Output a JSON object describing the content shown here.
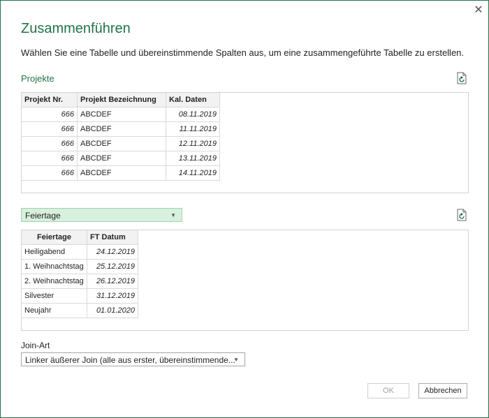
{
  "dialog": {
    "title": "Zusammenführen",
    "description": "Wählen Sie eine Tabelle und übereinstimmende Spalten aus, um eine zusammengeführte Tabelle zu erstellen."
  },
  "first_table": {
    "label": "Projekte",
    "columns": [
      "Projekt Nr.",
      "Projekt Bezeichnung",
      "Kal. Daten"
    ],
    "rows": [
      [
        "666",
        "ABCDEF",
        "08.11.2019"
      ],
      [
        "666",
        "ABCDEF",
        "11.11.2019"
      ],
      [
        "666",
        "ABCDEF",
        "12.11.2019"
      ],
      [
        "666",
        "ABCDEF",
        "13.11.2019"
      ],
      [
        "666",
        "ABCDEF",
        "14.11.2019"
      ]
    ]
  },
  "second_table": {
    "selected": "Feiertage",
    "columns": [
      "Feiertage",
      "FT Datum"
    ],
    "rows": [
      [
        "Heiligabend",
        "24.12.2019"
      ],
      [
        "1. Weihnachtstag",
        "25.12.2019"
      ],
      [
        "2. Weihnachtstag",
        "26.12.2019"
      ],
      [
        "Silvester",
        "31.12.2019"
      ],
      [
        "Neujahr",
        "01.01.2020"
      ]
    ]
  },
  "join": {
    "label": "Join-Art",
    "selected": "Linker äußerer Join (alle aus erster, übereinstimmende..."
  },
  "buttons": {
    "ok": "OK",
    "cancel": "Abbrechen"
  },
  "colors": {
    "accent": "#217346",
    "selected_dropdown": "#d8f0de"
  }
}
